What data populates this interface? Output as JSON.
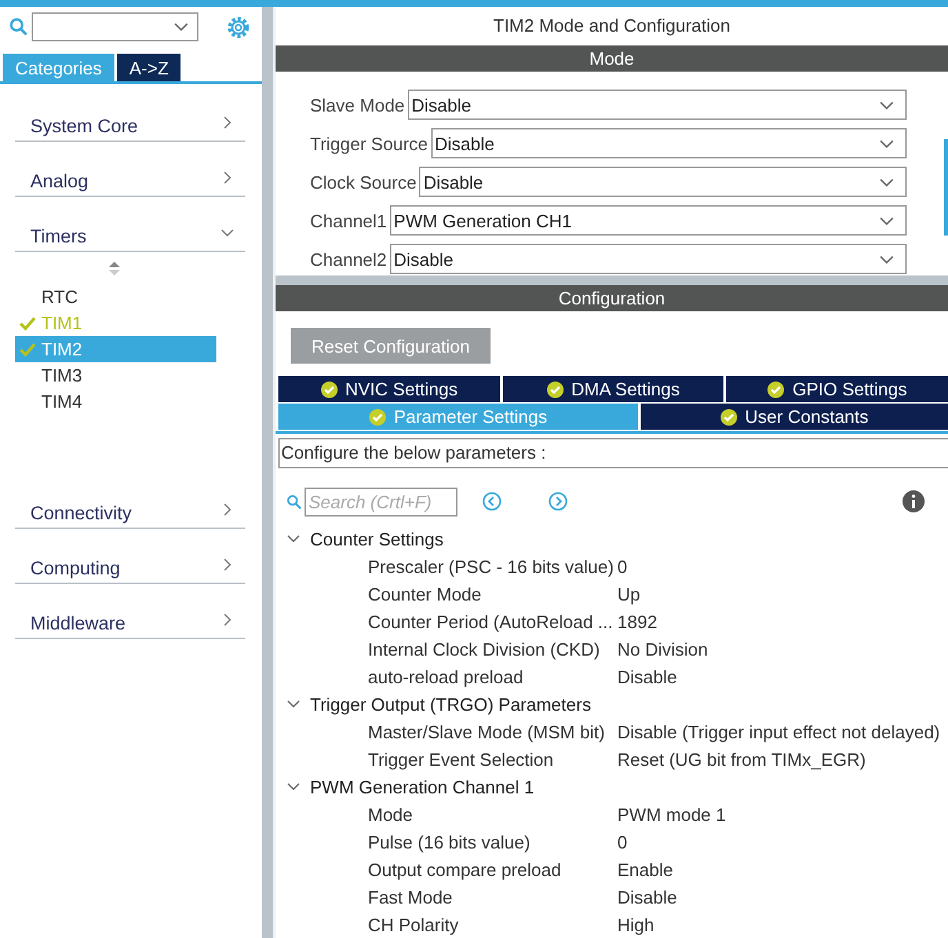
{
  "sidebar": {
    "tabs": [
      {
        "label": "Categories",
        "selected": true
      },
      {
        "label": "A->Z",
        "selected": false
      }
    ],
    "categories": [
      {
        "label": "System Core",
        "expanded": false
      },
      {
        "label": "Analog",
        "expanded": false
      },
      {
        "label": "Timers",
        "expanded": true,
        "children": [
          {
            "label": "RTC",
            "checked": false,
            "selected": false
          },
          {
            "label": "TIM1",
            "checked": true,
            "selected": false
          },
          {
            "label": "TIM2",
            "checked": true,
            "selected": true
          },
          {
            "label": "TIM3",
            "checked": false,
            "selected": false
          },
          {
            "label": "TIM4",
            "checked": false,
            "selected": false
          }
        ]
      },
      {
        "label": "Connectivity",
        "expanded": false
      },
      {
        "label": "Computing",
        "expanded": false
      },
      {
        "label": "Middleware",
        "expanded": false
      }
    ]
  },
  "main": {
    "title": "TIM2 Mode and Configuration",
    "mode": {
      "header": "Mode",
      "fields": [
        {
          "label": "Slave Mode",
          "value": "Disable"
        },
        {
          "label": "Trigger Source",
          "value": "Disable"
        },
        {
          "label": "Clock Source",
          "value": "Disable"
        },
        {
          "label": "Channel1",
          "value": "PWM Generation CH1"
        },
        {
          "label": "Channel2",
          "value": "Disable"
        }
      ]
    },
    "configuration": {
      "header": "Configuration",
      "reset_button": "Reset Configuration",
      "tab_rows": [
        [
          {
            "label": "NVIC Settings",
            "selected": false
          },
          {
            "label": "DMA Settings",
            "selected": false
          },
          {
            "label": "GPIO Settings",
            "selected": false
          }
        ],
        [
          {
            "label": "Parameter Settings",
            "selected": true
          },
          {
            "label": "User Constants",
            "selected": false
          }
        ]
      ],
      "hint": "Configure the below parameters :",
      "search": {
        "placeholder": "Search (Crtl+F)"
      },
      "groups": [
        {
          "label": "Counter Settings",
          "expanded": true,
          "items": [
            {
              "label": "Prescaler (PSC - 16 bits value)",
              "value": "0"
            },
            {
              "label": "Counter Mode",
              "value": "Up"
            },
            {
              "label": "Counter Period (AutoReload ...",
              "value": "1892"
            },
            {
              "label": "Internal Clock Division (CKD)",
              "value": "No Division"
            },
            {
              "label": "auto-reload preload",
              "value": "Disable"
            }
          ]
        },
        {
          "label": "Trigger Output (TRGO) Parameters",
          "expanded": true,
          "items": [
            {
              "label": "Master/Slave Mode (MSM bit)",
              "value": "Disable (Trigger input effect not delayed)"
            },
            {
              "label": "Trigger Event Selection",
              "value": "Reset (UG bit from TIMx_EGR)"
            }
          ]
        },
        {
          "label": "PWM Generation Channel 1",
          "expanded": true,
          "items": [
            {
              "label": "Mode",
              "value": "PWM mode 1"
            },
            {
              "label": "Pulse (16 bits value)",
              "value": "0"
            },
            {
              "label": "Output compare preload",
              "value": "Enable"
            },
            {
              "label": "Fast Mode",
              "value": "Disable"
            },
            {
              "label": "CH Polarity",
              "value": "High"
            }
          ]
        }
      ]
    }
  }
}
